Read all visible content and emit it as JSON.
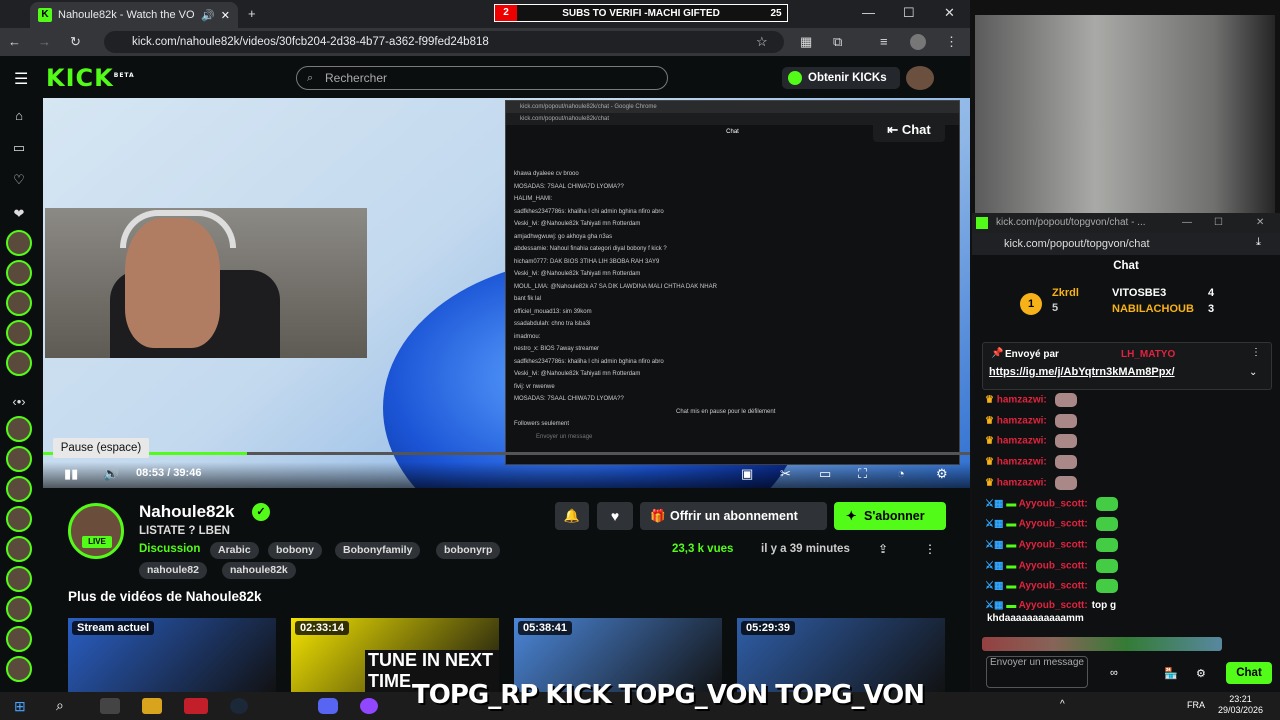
{
  "browser": {
    "tab_title": "Nahoule82k - Watch the VO",
    "url": "kick.com/nahoule82k/videos/30fcb204-2d38-4b77-a362-f99fed24b818"
  },
  "subs_banner": {
    "left": "2",
    "text": "SUBS TO VERIFI -MACHI GIFTED",
    "right": "25"
  },
  "kick": {
    "logo": "KICK",
    "logo_sup": "BETA",
    "search_placeholder": "Rechercher",
    "get_kicks": "Obtenir KICKs"
  },
  "video": {
    "tooltip": "Pause (espace)",
    "time": "08:53 / 39:46",
    "progress_fraction": 0.22,
    "chat_overlay_label": "Chat",
    "inner_chat_url": "kick.com/popout/nahoule82k/chat",
    "inner_chat_window": "kick.com/popout/nahoule82k/chat - Google Chrome",
    "inner_chat_title": "Chat",
    "inner_lines": [
      "khawa dyaleee cv brooo",
      "MOSADAS: 7SAAL CHIWA7D LYOMA??",
      "HALIM_HAMI:",
      "sadfkhes2347786s: khaliha l chi admin bghina nfiro abro",
      "Veski_lvi: @Nahoule82k Tahiyati mn Rotterdam",
      "amjadhwgwuwj: go akhoya gha n3as",
      "abdessamie: Nahoul finahia categori diyal bobony f kick ?",
      "hicham0777: DAK BIOS 3TIHA LIH 3BOBA RAH 3AY9",
      "Veski_lvi: @Nahoule82k Tahiyati mn Rotterdam",
      "MOUL_LMA: @Nahoule82k A7 SA DIK LAWDINA MALI CHTHA DAK NHAR",
      "bant fik lal",
      "officiel_mouad13: sim 39kom",
      "ssadabdulah: chno tra lsba3i",
      "imadmou:",
      "nestro_x: BIOS 7away streamer",
      "sadfkhes2347786s: khaliha l chi admin bghina nfiro abro",
      "Veski_lvi: @Nahoule82k Tahiyati mn Rotterdam",
      "fivij: vr nwenwe",
      "MOSADAS: 7SAAL CHIWA7D LYOMA??",
      "Chat mis en pause pour le défilement",
      "Followers seulement",
      "Envoyer un message"
    ]
  },
  "channel": {
    "name": "Nahoule82k",
    "live": "LIVE",
    "title": "LISTATE ? LBEN",
    "category": "Discussion",
    "tags": [
      "Arabic",
      "bobony",
      "Bobonyfamily",
      "bobonyrp",
      "nahoule82",
      "nahoule82k"
    ],
    "offer_label": "Offrir un abonnement",
    "subscribe_label": "S'abonner",
    "views": "23,3 k vues",
    "ago": "il y a 39 minutes"
  },
  "more": {
    "title": "Plus de vidéos de Nahoule82k",
    "thumbs": [
      {
        "label": "Stream actuel",
        "color": "#2a5fc4"
      },
      {
        "label": "02:33:14",
        "color": "#f3e400",
        "text": "TUNE IN NEXT TIME"
      },
      {
        "label": "05:38:41",
        "color": "#4b86d8"
      },
      {
        "label": "05:29:39",
        "color": "#2f5ea8"
      }
    ]
  },
  "right_chat": {
    "window_title": "kick.com/popout/topgvon/chat - ...",
    "url": "kick.com/popout/topgvon/chat",
    "title": "Chat",
    "gifter1": "Zkrdl",
    "gifter1_count": "5",
    "gifter2": "VITOSBE3",
    "gifter2_count": "4",
    "gifter3": "NABILACHOUB",
    "gifter3_count": "3",
    "pinned_by": "Envoyé par",
    "pinned_user": "LH_MATYO",
    "pinned_link": "https://ig.me/j/AbYqtrn3kMAm8Ppx/",
    "lines": [
      {
        "user": "hamzazwi:",
        "msg": ""
      },
      {
        "user": "hamzazwi:",
        "msg": ""
      },
      {
        "user": "hamzazwi:",
        "msg": ""
      },
      {
        "user": "hamzazwi:",
        "msg": ""
      },
      {
        "user": "hamzazwi:",
        "msg": ""
      },
      {
        "user": "Ayyoub_scott:",
        "msg": ""
      },
      {
        "user": "Ayyoub_scott:",
        "msg": ""
      },
      {
        "user": "Ayyoub_scott:",
        "msg": ""
      },
      {
        "user": "Ayyoub_scott:",
        "msg": ""
      },
      {
        "user": "Ayyoub_scott:",
        "msg": ""
      },
      {
        "user": "Ayyoub_scott:",
        "msg": "top g"
      }
    ],
    "last_line": "khdaaaaaaaaaaamm",
    "input_placeholder": "Envoyer un message",
    "send_label": "Chat"
  },
  "taskbar": {
    "overlay_text": "TOPG_RP KICK TOPG_VON TOPG_VON",
    "lang": "FRA",
    "time": "23:21",
    "date": "29/03/2026"
  },
  "colors": {
    "accent": "#53fc18",
    "user_red": "#e0233f",
    "bg": "#0b0e0f"
  }
}
